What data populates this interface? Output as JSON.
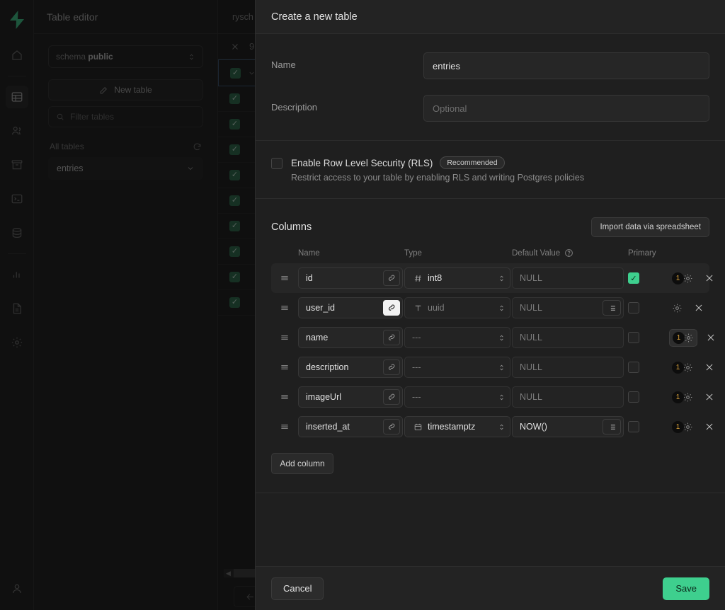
{
  "rail": {
    "logo": "supabase-logo",
    "items": [
      {
        "name": "home-icon"
      },
      {
        "name": "table-editor-icon",
        "active": true
      },
      {
        "name": "authentication-users-icon"
      },
      {
        "name": "storage-icon"
      },
      {
        "name": "sql-editor-icon"
      },
      {
        "name": "database-icon"
      },
      {
        "name": "reports-icon"
      },
      {
        "name": "logs-icon"
      },
      {
        "name": "settings-icon"
      }
    ],
    "account_icon": "user-avatar-icon"
  },
  "nav": {
    "title": "Table editor",
    "schema_prefix": "schema",
    "schema_value": "public",
    "new_table_label": "New table",
    "filter_placeholder": "Filter tables",
    "all_tables_label": "All tables",
    "tables": [
      "entries"
    ]
  },
  "grid": {
    "tab_label": "rysch",
    "close_icon": "close-icon",
    "row_count_label": "9",
    "checked_rows": 10
  },
  "panel": {
    "title": "Create a new table",
    "name_label": "Name",
    "name_value": "entries",
    "description_label": "Description",
    "description_placeholder": "Optional",
    "rls": {
      "title": "Enable Row Level Security (RLS)",
      "badge": "Recommended",
      "subtitle": "Restrict access to your table by enabling RLS and writing Postgres policies",
      "checked": false
    },
    "columns_title": "Columns",
    "import_label": "Import data via spreadsheet",
    "column_headers": {
      "name": "Name",
      "type": "Type",
      "default": "Default Value",
      "default_help_icon": "help-circle-icon",
      "primary": "Primary"
    },
    "columns": [
      {
        "name": "id",
        "type": "int8",
        "type_icon": "hash-icon",
        "default": "NULL",
        "default_is_placeholder": true,
        "has_default_list": false,
        "primary": true,
        "link_active": false,
        "settings_count": "1",
        "settings_boxed": false,
        "highlighted": true
      },
      {
        "name": "user_id",
        "type": "uuid",
        "type_icon": "text-icon",
        "default": "NULL",
        "default_is_placeholder": true,
        "has_default_list": true,
        "primary": false,
        "link_active": true,
        "settings_count": "",
        "settings_boxed": false,
        "highlighted": false
      },
      {
        "name": "name",
        "type": "---",
        "type_icon": "",
        "default": "NULL",
        "default_is_placeholder": true,
        "has_default_list": false,
        "primary": false,
        "link_active": false,
        "settings_count": "1",
        "settings_boxed": true,
        "highlighted": false
      },
      {
        "name": "description",
        "type": "---",
        "type_icon": "",
        "default": "NULL",
        "default_is_placeholder": true,
        "has_default_list": false,
        "primary": false,
        "link_active": false,
        "settings_count": "1",
        "settings_boxed": false,
        "highlighted": false
      },
      {
        "name": "imageUrl",
        "type": "---",
        "type_icon": "",
        "default": "NULL",
        "default_is_placeholder": true,
        "has_default_list": false,
        "primary": false,
        "link_active": false,
        "settings_count": "1",
        "settings_boxed": false,
        "highlighted": false
      },
      {
        "name": "inserted_at",
        "type": "timestamptz",
        "type_icon": "calendar-icon",
        "default": "NOW()",
        "default_is_placeholder": false,
        "has_default_list": true,
        "primary": false,
        "link_active": false,
        "settings_count": "1",
        "settings_boxed": false,
        "highlighted": false
      }
    ],
    "add_column_label": "Add column",
    "cancel_label": "Cancel",
    "save_label": "Save"
  },
  "colors": {
    "accent_green": "#3ecf8e",
    "panel_bg": "#1f1f1f",
    "app_bg": "#1b1b1b",
    "badge_number": "#d9a23b"
  }
}
